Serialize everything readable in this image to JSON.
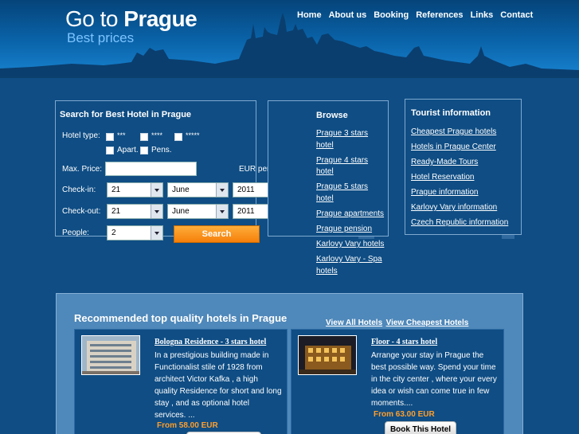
{
  "header": {
    "logo_prefix": "Go to",
    "logo_main": "Prague",
    "tagline": "Best prices",
    "nav": [
      "Home",
      "About us",
      "Booking",
      "References",
      "Links",
      "Contact"
    ]
  },
  "search": {
    "title": "Search for Best Hotel in Prague",
    "hotel_type_label": "Hotel type:",
    "stars_3": "***",
    "stars_4": "****",
    "stars_5": "*****",
    "apart_label": "Apart.",
    "pens_label": "Pens.",
    "max_price_label": "Max. Price:",
    "max_price_value": "",
    "price_unit": "EUR per Day",
    "checkin_label": "Check-in:",
    "checkin_day": "21",
    "checkin_month": "June",
    "checkin_year": "2011",
    "checkout_label": "Check-out:",
    "checkout_day": "21",
    "checkout_month": "June",
    "checkout_year": "2011",
    "people_label": "People:",
    "people_value": "2",
    "submit_label": "Search"
  },
  "browse": {
    "title": "Browse",
    "links": [
      "Prague 3 stars",
      "hotel",
      "Prague 4 stars",
      "hotel",
      "Prague 5 stars",
      "hotel",
      "Prague apartments",
      "Prague pension",
      "Karlovy Vary hotels",
      "Karlovy Vary - Spa",
      "hotels"
    ]
  },
  "tourist": {
    "title": "Tourist information",
    "links": [
      "Cheapest Prague hotels",
      "Hotels in Prague Center",
      "Ready-Made Tours",
      "Hotel Reservation",
      "Prague information",
      "Karlovy Vary information",
      "Czech Republic information"
    ]
  },
  "recommended": {
    "title": "Recommended top quality hotels in Prague",
    "view_all": "View All Hotels",
    "view_cheapest": "View Cheapest Hotels",
    "hotels": [
      {
        "name": "Bologna Residence - 3 stars hotel",
        "lines": [
          "In a prestigious building made in",
          "Functionalist stile of 1928 from",
          "architect Victor Kafka , a high",
          "quality Residence for short and long",
          "stay , and as optional hotel",
          "services. ..."
        ],
        "price": "From 58.00 EUR"
      },
      {
        "name": "Floor - 4 stars hotel",
        "lines": [
          "Arrange your stay in Prague the",
          "best possible way. Spend your time",
          "in the city center , where your every",
          "idea or wish can come true in few",
          "moments...."
        ],
        "price": "From 63.00 EUR",
        "book_label": "Book This Hotel"
      }
    ]
  },
  "colors": {
    "background": "#0f4d84",
    "header_top": "#05447a",
    "header_bottom": "#1883d0",
    "accent_orange": "#f57f0a",
    "price_orange": "#ff9e2c",
    "rec_box": "#4f88ba"
  },
  "icons": [
    "calendar-icon",
    "chevron-down-icon"
  ]
}
